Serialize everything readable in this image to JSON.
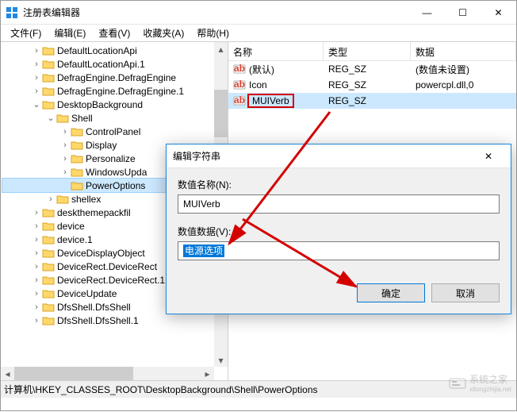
{
  "window": {
    "title": "注册表编辑器",
    "min": "—",
    "max": "☐",
    "close": "✕"
  },
  "menu": {
    "file": "文件(F)",
    "edit": "编辑(E)",
    "view": "查看(V)",
    "favorites": "收藏夹(A)",
    "help": "帮助(H)"
  },
  "tree": {
    "items": [
      {
        "indent": 2,
        "tw": "›",
        "label": "DefaultLocationApi"
      },
      {
        "indent": 2,
        "tw": "›",
        "label": "DefaultLocationApi.1"
      },
      {
        "indent": 2,
        "tw": "›",
        "label": "DefragEngine.DefragEngine"
      },
      {
        "indent": 2,
        "tw": "›",
        "label": "DefragEngine.DefragEngine.1"
      },
      {
        "indent": 2,
        "tw": "⌄",
        "label": "DesktopBackground"
      },
      {
        "indent": 3,
        "tw": "⌄",
        "label": "Shell"
      },
      {
        "indent": 4,
        "tw": "›",
        "label": "ControlPanel"
      },
      {
        "indent": 4,
        "tw": "›",
        "label": "Display"
      },
      {
        "indent": 4,
        "tw": "›",
        "label": "Personalize"
      },
      {
        "indent": 4,
        "tw": "›",
        "label": "WindowsUpda"
      },
      {
        "indent": 4,
        "tw": "",
        "label": "PowerOptions",
        "selected": true
      },
      {
        "indent": 3,
        "tw": "›",
        "label": "shellex"
      },
      {
        "indent": 2,
        "tw": "›",
        "label": "deskthemepackfil"
      },
      {
        "indent": 2,
        "tw": "›",
        "label": "device"
      },
      {
        "indent": 2,
        "tw": "›",
        "label": "device.1"
      },
      {
        "indent": 2,
        "tw": "›",
        "label": "DeviceDisplayObject"
      },
      {
        "indent": 2,
        "tw": "›",
        "label": "DeviceRect.DeviceRect"
      },
      {
        "indent": 2,
        "tw": "›",
        "label": "DeviceRect.DeviceRect.1"
      },
      {
        "indent": 2,
        "tw": "›",
        "label": "DeviceUpdate"
      },
      {
        "indent": 2,
        "tw": "›",
        "label": "DfsShell.DfsShell"
      },
      {
        "indent": 2,
        "tw": "›",
        "label": "DfsShell.DfsShell.1"
      }
    ]
  },
  "list": {
    "columns": {
      "name": "名称",
      "type": "类型",
      "data": "数据"
    },
    "col_widths": {
      "name": 120,
      "type": 110,
      "data": 130
    },
    "rows": [
      {
        "name": "(默认)",
        "type": "REG_SZ",
        "data": "(数值未设置)"
      },
      {
        "name": "Icon",
        "type": "REG_SZ",
        "data": "powercpl.dll,0"
      },
      {
        "name": "MUIVerb",
        "type": "REG_SZ",
        "data": "",
        "selected": true,
        "highlight": true
      }
    ]
  },
  "dialog": {
    "title": "编辑字符串",
    "name_label": "数值名称(N):",
    "name_value": "MUIVerb",
    "data_label": "数值数据(V):",
    "data_value": "电源选项",
    "ok": "确定",
    "cancel": "取消",
    "close": "✕"
  },
  "statusbar": {
    "path": "计算机\\HKEY_CLASSES_ROOT\\DesktopBackground\\Shell\\PowerOptions"
  },
  "watermark": {
    "text": "系统之家",
    "url": "xitongzhijia.net"
  }
}
